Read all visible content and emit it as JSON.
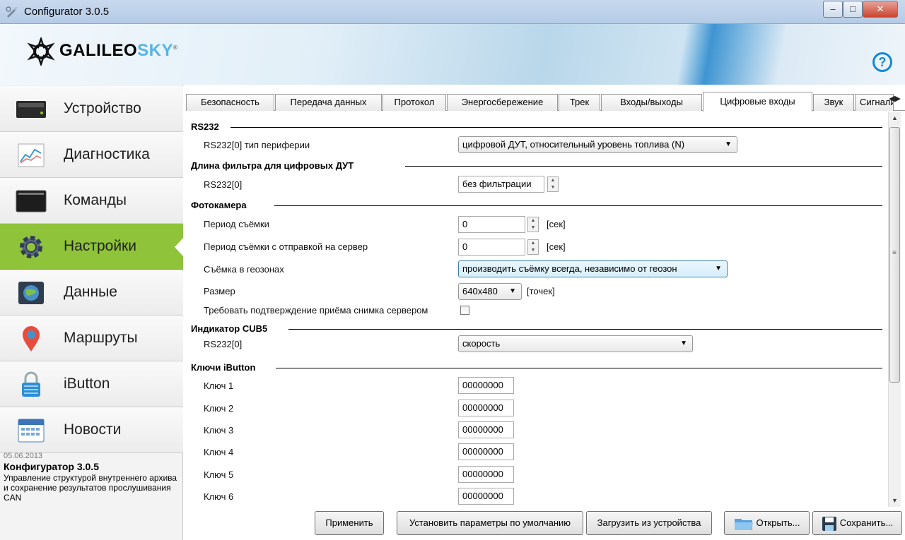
{
  "window": {
    "title": "Configurator 3.0.5",
    "minimize": "–",
    "maximize": "□",
    "close": "✕"
  },
  "header": {
    "logo_main": "GALILEO",
    "logo_accent": "SKY",
    "logo_reg": "®",
    "help": "?"
  },
  "sidebar": {
    "items": [
      {
        "label": "Устройство",
        "icon": "device-icon",
        "active": false
      },
      {
        "label": "Диагностика",
        "icon": "diagnostics-chart-icon",
        "active": false
      },
      {
        "label": "Команды",
        "icon": "terminal-icon",
        "active": false
      },
      {
        "label": "Настройки",
        "icon": "gear-icon",
        "active": true
      },
      {
        "label": "Данные",
        "icon": "data-globe-icon",
        "active": false
      },
      {
        "label": "Маршруты",
        "icon": "map-pin-icon",
        "active": false
      },
      {
        "label": "iButton",
        "icon": "lock-icon",
        "active": false
      },
      {
        "label": "Новости",
        "icon": "calendar-icon",
        "active": false
      }
    ],
    "news": {
      "date": "05.06.2013",
      "title": "Конфигуратор 3.0.5",
      "body": "Управление структурой внутреннего архива и сохранение результатов прослушивания CAN"
    }
  },
  "tabs": [
    "Безопасность",
    "Передача данных",
    "Протокол",
    "Энергосбережение",
    "Трек",
    "Входы/выходы",
    "Цифровые входы",
    "Звук",
    "Сигнали"
  ],
  "active_tab": "Цифровые входы",
  "form": {
    "rs232": {
      "section": "RS232",
      "type_label": "RS232[0] тип периферии",
      "type_value": "цифровой ДУТ, относительный уровень топлива (N)"
    },
    "filter": {
      "section": "Длина фильтра для цифровых ДУТ",
      "label": "RS232[0]",
      "value": "без фильтрации"
    },
    "camera": {
      "section": "Фотокамера",
      "period_label": "Период съёмки",
      "period_value": "0",
      "period_unit": "[сек]",
      "period_send_label": "Период съёмки с отправкой на сервер",
      "period_send_value": "0",
      "period_send_unit": "[сек]",
      "geozone_label": "Съёмка в геозонах",
      "geozone_value": "производить съёмку всегда, независимо от геозон",
      "size_label": "Размер",
      "size_value": "640x480",
      "size_unit": "[точек]",
      "confirm_label": "Требовать подтверждение приёма снимка сервером",
      "confirm_checked": false
    },
    "cub5": {
      "section": "Индикатор CUB5",
      "label": "RS232[0]",
      "value": "скорость"
    },
    "ibutton": {
      "section": "Ключи iButton",
      "keys": [
        {
          "label": "Ключ 1",
          "value": "00000000"
        },
        {
          "label": "Ключ 2",
          "value": "00000000"
        },
        {
          "label": "Ключ 3",
          "value": "00000000"
        },
        {
          "label": "Ключ 4",
          "value": "00000000"
        },
        {
          "label": "Ключ 5",
          "value": "00000000"
        },
        {
          "label": "Ключ 6",
          "value": "00000000"
        }
      ]
    }
  },
  "buttons": {
    "apply": "Применить",
    "defaults": "Установить параметры по умолчанию",
    "load": "Загрузить из устройства",
    "open": "Открыть...",
    "save": "Сохранить..."
  },
  "colors": {
    "accent_green": "#8fc43a",
    "accent_blue": "#1487d6"
  }
}
